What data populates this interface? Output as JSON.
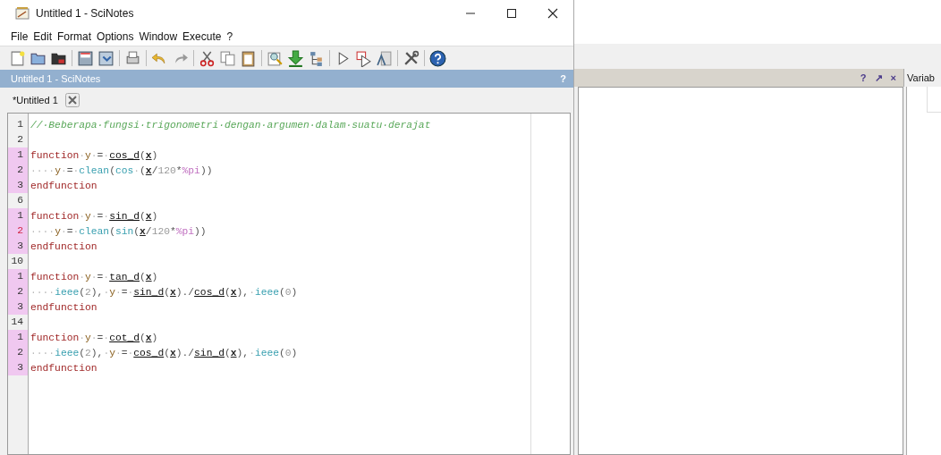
{
  "window": {
    "title": "Untitled 1 - SciNotes"
  },
  "menu": [
    "File",
    "Edit",
    "Format",
    "Options",
    "Window",
    "Execute",
    "?"
  ],
  "dock": {
    "title": "Untitled 1 - SciNotes",
    "help": "?"
  },
  "tabs": [
    {
      "label": "*Untitled 1",
      "selected": true
    }
  ],
  "editor": {
    "lines": [
      {
        "number": "1",
        "in_function": false,
        "current": false,
        "tokens": [
          {
            "kind": "comment",
            "text": "//·Beberapa·fungsi·trigonometri·dengan·argumen·dalam·suatu·derajat"
          }
        ]
      },
      {
        "number": "2",
        "in_function": false,
        "current": false
      },
      {
        "number": "1",
        "in_function": true,
        "current": false,
        "tokens": [
          {
            "kind": "keyword",
            "text": "function"
          },
          {
            "kind": "ws",
            "text": "·"
          },
          {
            "kind": "var",
            "text": "y"
          },
          {
            "kind": "ws",
            "text": "·"
          },
          {
            "kind": "op",
            "text": "="
          },
          {
            "kind": "ws",
            "text": "·"
          },
          {
            "kind": "fn",
            "text": "cos_d"
          },
          {
            "kind": "op",
            "text": "("
          },
          {
            "kind": "arg",
            "text": "x"
          },
          {
            "kind": "op",
            "text": ")"
          }
        ]
      },
      {
        "number": "2",
        "in_function": true,
        "current": false,
        "tokens": [
          {
            "kind": "ws",
            "text": "····"
          },
          {
            "kind": "var",
            "text": "y"
          },
          {
            "kind": "ws",
            "text": "·"
          },
          {
            "kind": "op",
            "text": "="
          },
          {
            "kind": "ws",
            "text": "·"
          },
          {
            "kind": "builtin",
            "text": "clean"
          },
          {
            "kind": "op",
            "text": "("
          },
          {
            "kind": "builtin",
            "text": "cos"
          },
          {
            "kind": "ws",
            "text": "·"
          },
          {
            "kind": "op",
            "text": "("
          },
          {
            "kind": "arg",
            "text": "x"
          },
          {
            "kind": "op",
            "text": "/"
          },
          {
            "kind": "number",
            "text": "120"
          },
          {
            "kind": "op",
            "text": "*"
          },
          {
            "kind": "const",
            "text": "%pi"
          },
          {
            "kind": "op",
            "text": "))"
          }
        ]
      },
      {
        "number": "3",
        "in_function": true,
        "current": false,
        "tokens": [
          {
            "kind": "keyword",
            "text": "endfunction"
          }
        ]
      },
      {
        "number": "6",
        "in_function": false,
        "current": false
      },
      {
        "number": "1",
        "in_function": true,
        "current": false,
        "tokens": [
          {
            "kind": "keyword",
            "text": "function"
          },
          {
            "kind": "ws",
            "text": "·"
          },
          {
            "kind": "var",
            "text": "y"
          },
          {
            "kind": "ws",
            "text": "·"
          },
          {
            "kind": "op",
            "text": "="
          },
          {
            "kind": "ws",
            "text": "·"
          },
          {
            "kind": "fn",
            "text": "sin_d"
          },
          {
            "kind": "op",
            "text": "("
          },
          {
            "kind": "arg",
            "text": "x"
          },
          {
            "kind": "op",
            "text": ")"
          }
        ]
      },
      {
        "number": "2",
        "in_function": true,
        "current": true,
        "tokens": [
          {
            "kind": "ws",
            "text": "····"
          },
          {
            "kind": "var",
            "text": "y"
          },
          {
            "kind": "ws",
            "text": "·"
          },
          {
            "kind": "op",
            "text": "="
          },
          {
            "kind": "ws",
            "text": "·"
          },
          {
            "kind": "builtin",
            "text": "clean"
          },
          {
            "kind": "op",
            "text": "("
          },
          {
            "kind": "builtin",
            "text": "sin"
          },
          {
            "kind": "op",
            "text": "("
          },
          {
            "kind": "arg",
            "text": "x"
          },
          {
            "kind": "op",
            "text": "/"
          },
          {
            "kind": "number",
            "text": "120"
          },
          {
            "kind": "op",
            "text": "*"
          },
          {
            "kind": "const",
            "text": "%pi"
          },
          {
            "kind": "op",
            "text": "))"
          }
        ]
      },
      {
        "number": "3",
        "in_function": true,
        "current": false,
        "tokens": [
          {
            "kind": "keyword",
            "text": "endfunction"
          }
        ]
      },
      {
        "number": "10",
        "in_function": false,
        "current": false
      },
      {
        "number": "1",
        "in_function": true,
        "current": false,
        "tokens": [
          {
            "kind": "keyword",
            "text": "function"
          },
          {
            "kind": "ws",
            "text": "·"
          },
          {
            "kind": "var",
            "text": "y"
          },
          {
            "kind": "ws",
            "text": "·"
          },
          {
            "kind": "op",
            "text": "="
          },
          {
            "kind": "ws",
            "text": "·"
          },
          {
            "kind": "fn",
            "text": "tan_d"
          },
          {
            "kind": "op",
            "text": "("
          },
          {
            "kind": "arg",
            "text": "x"
          },
          {
            "kind": "op",
            "text": ")"
          }
        ]
      },
      {
        "number": "2",
        "in_function": true,
        "current": false,
        "tokens": [
          {
            "kind": "ws",
            "text": "····"
          },
          {
            "kind": "builtin",
            "text": "ieee"
          },
          {
            "kind": "op",
            "text": "("
          },
          {
            "kind": "number",
            "text": "2"
          },
          {
            "kind": "op",
            "text": "),"
          },
          {
            "kind": "ws",
            "text": "·"
          },
          {
            "kind": "var",
            "text": "y"
          },
          {
            "kind": "ws",
            "text": "·"
          },
          {
            "kind": "op",
            "text": "="
          },
          {
            "kind": "ws",
            "text": "·"
          },
          {
            "kind": "fn",
            "text": "sin_d"
          },
          {
            "kind": "op",
            "text": "("
          },
          {
            "kind": "arg",
            "text": "x"
          },
          {
            "kind": "op",
            "text": ")./"
          },
          {
            "kind": "fn",
            "text": "cos_d"
          },
          {
            "kind": "op",
            "text": "("
          },
          {
            "kind": "arg",
            "text": "x"
          },
          {
            "kind": "op",
            "text": "),"
          },
          {
            "kind": "ws",
            "text": "·"
          },
          {
            "kind": "builtin",
            "text": "ieee"
          },
          {
            "kind": "op",
            "text": "("
          },
          {
            "kind": "number",
            "text": "0"
          },
          {
            "kind": "op",
            "text": ")"
          }
        ]
      },
      {
        "number": "3",
        "in_function": true,
        "current": false,
        "tokens": [
          {
            "kind": "keyword",
            "text": "endfunction"
          }
        ]
      },
      {
        "number": "14",
        "in_function": false,
        "current": false
      },
      {
        "number": "1",
        "in_function": true,
        "current": false,
        "tokens": [
          {
            "kind": "keyword",
            "text": "function"
          },
          {
            "kind": "ws",
            "text": "·"
          },
          {
            "kind": "var",
            "text": "y"
          },
          {
            "kind": "ws",
            "text": "·"
          },
          {
            "kind": "op",
            "text": "="
          },
          {
            "kind": "ws",
            "text": "·"
          },
          {
            "kind": "fn",
            "text": "cot_d"
          },
          {
            "kind": "op",
            "text": "("
          },
          {
            "kind": "arg",
            "text": "x"
          },
          {
            "kind": "op",
            "text": ")"
          }
        ]
      },
      {
        "number": "2",
        "in_function": true,
        "current": false,
        "tokens": [
          {
            "kind": "ws",
            "text": "····"
          },
          {
            "kind": "builtin",
            "text": "ieee"
          },
          {
            "kind": "op",
            "text": "("
          },
          {
            "kind": "number",
            "text": "2"
          },
          {
            "kind": "op",
            "text": "),"
          },
          {
            "kind": "ws",
            "text": "·"
          },
          {
            "kind": "var",
            "text": "y"
          },
          {
            "kind": "ws",
            "text": "·"
          },
          {
            "kind": "op",
            "text": "="
          },
          {
            "kind": "ws",
            "text": "·"
          },
          {
            "kind": "fn",
            "text": "cos_d"
          },
          {
            "kind": "op",
            "text": "("
          },
          {
            "kind": "arg",
            "text": "x"
          },
          {
            "kind": "op",
            "text": ")./"
          },
          {
            "kind": "fn",
            "text": "sin_d"
          },
          {
            "kind": "op",
            "text": "("
          },
          {
            "kind": "arg",
            "text": "x"
          },
          {
            "kind": "op",
            "text": "),"
          },
          {
            "kind": "ws",
            "text": "·"
          },
          {
            "kind": "builtin",
            "text": "ieee"
          },
          {
            "kind": "op",
            "text": "("
          },
          {
            "kind": "number",
            "text": "0"
          },
          {
            "kind": "op",
            "text": ")"
          }
        ]
      },
      {
        "number": "3",
        "in_function": true,
        "current": false,
        "tokens": [
          {
            "kind": "keyword",
            "text": "endfunction"
          }
        ]
      }
    ]
  },
  "background_window": {
    "dock_buttons": [
      "?",
      "↗",
      "×"
    ],
    "variable_browser": {
      "title": "Variab"
    }
  }
}
